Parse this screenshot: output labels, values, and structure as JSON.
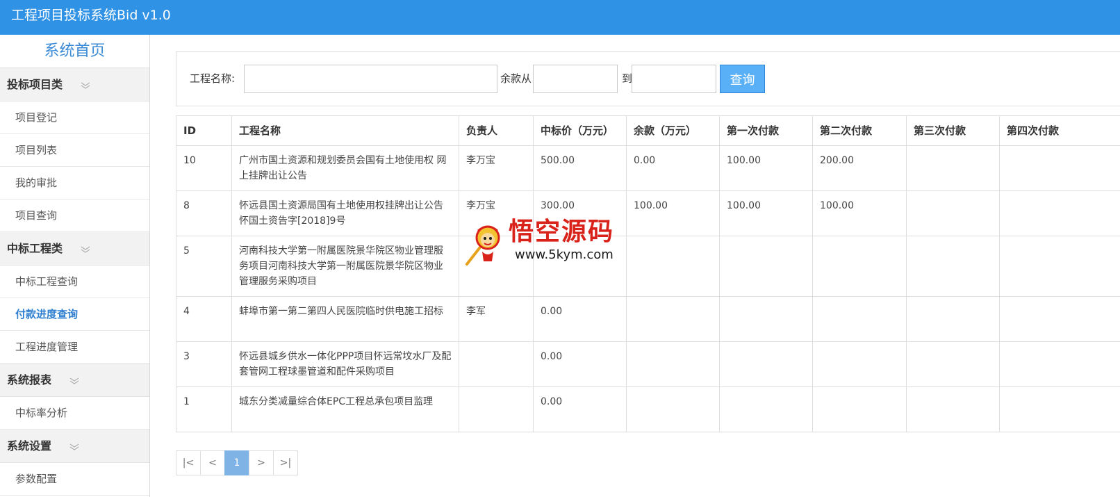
{
  "app": {
    "title": "工程项目投标系统Bid v1.0"
  },
  "sidebar": {
    "home": "系统首页",
    "groups": [
      {
        "label": "投标项目类",
        "items": [
          {
            "label": "项目登记"
          },
          {
            "label": "项目列表"
          },
          {
            "label": "我的审批"
          },
          {
            "label": "项目查询"
          }
        ]
      },
      {
        "label": "中标工程类",
        "items": [
          {
            "label": "中标工程查询"
          },
          {
            "label": "付款进度查询",
            "active": true
          },
          {
            "label": "工程进度管理"
          }
        ]
      },
      {
        "label": "系统报表",
        "items": [
          {
            "label": "中标率分析"
          }
        ]
      },
      {
        "label": "系统设置",
        "items": [
          {
            "label": "参数配置"
          }
        ]
      }
    ]
  },
  "search": {
    "name_label": "工程名称:",
    "name_value": "",
    "balance_from_label": "余款从",
    "balance_from_value": "",
    "to_label": "到",
    "balance_to_value": "",
    "button_label": "查询"
  },
  "table": {
    "columns": [
      "ID",
      "工程名称",
      "负责人",
      "中标价（万元）",
      "余款（万元）",
      "第一次付款",
      "第二次付款",
      "第三次付款",
      "第四次付款"
    ],
    "rows": [
      [
        "10",
        "广州市国土资源和规划委员会国有土地使用权 网上挂牌出让公告",
        "李万宝",
        "500.00",
        "0.00",
        "100.00",
        "200.00",
        "",
        ""
      ],
      [
        "8",
        "怀远县国土资源局国有土地使用权挂牌出让公告 怀国土资告字[2018]9号",
        "李万宝",
        "300.00",
        "100.00",
        "100.00",
        "100.00",
        "",
        ""
      ],
      [
        "5",
        "河南科技大学第一附属医院景华院区物业管理服务项目河南科技大学第一附属医院景华院区物业管理服务采购项目",
        "",
        "",
        "",
        "",
        "",
        "",
        ""
      ],
      [
        "4",
        "蚌埠市第一第二第四人民医院临时供电施工招标",
        "李军",
        "0.00",
        "",
        "",
        "",
        "",
        ""
      ],
      [
        "3",
        "怀远县城乡供水一体化PPP项目怀远常坟水厂及配套管网工程球墨管道和配件采购项目",
        "",
        "0.00",
        "",
        "",
        "",
        "",
        ""
      ],
      [
        "1",
        "城东分类减量综合体EPC工程总承包项目监理",
        "",
        "0.00",
        "",
        "",
        "",
        "",
        ""
      ]
    ]
  },
  "pagination": {
    "first": "|<",
    "prev": "<",
    "current": "1",
    "next": ">",
    "last": ">|"
  },
  "watermark": {
    "title": "悟空源码",
    "url": "www.5kym.com"
  },
  "colors": {
    "topbar": "#2f92e4",
    "home_link": "#3a8ad6",
    "active_item": "#2f7fd0",
    "query_button": "#5ab0f7",
    "pager_current": "#7fb3e6",
    "watermark_red": "#d9221a"
  }
}
